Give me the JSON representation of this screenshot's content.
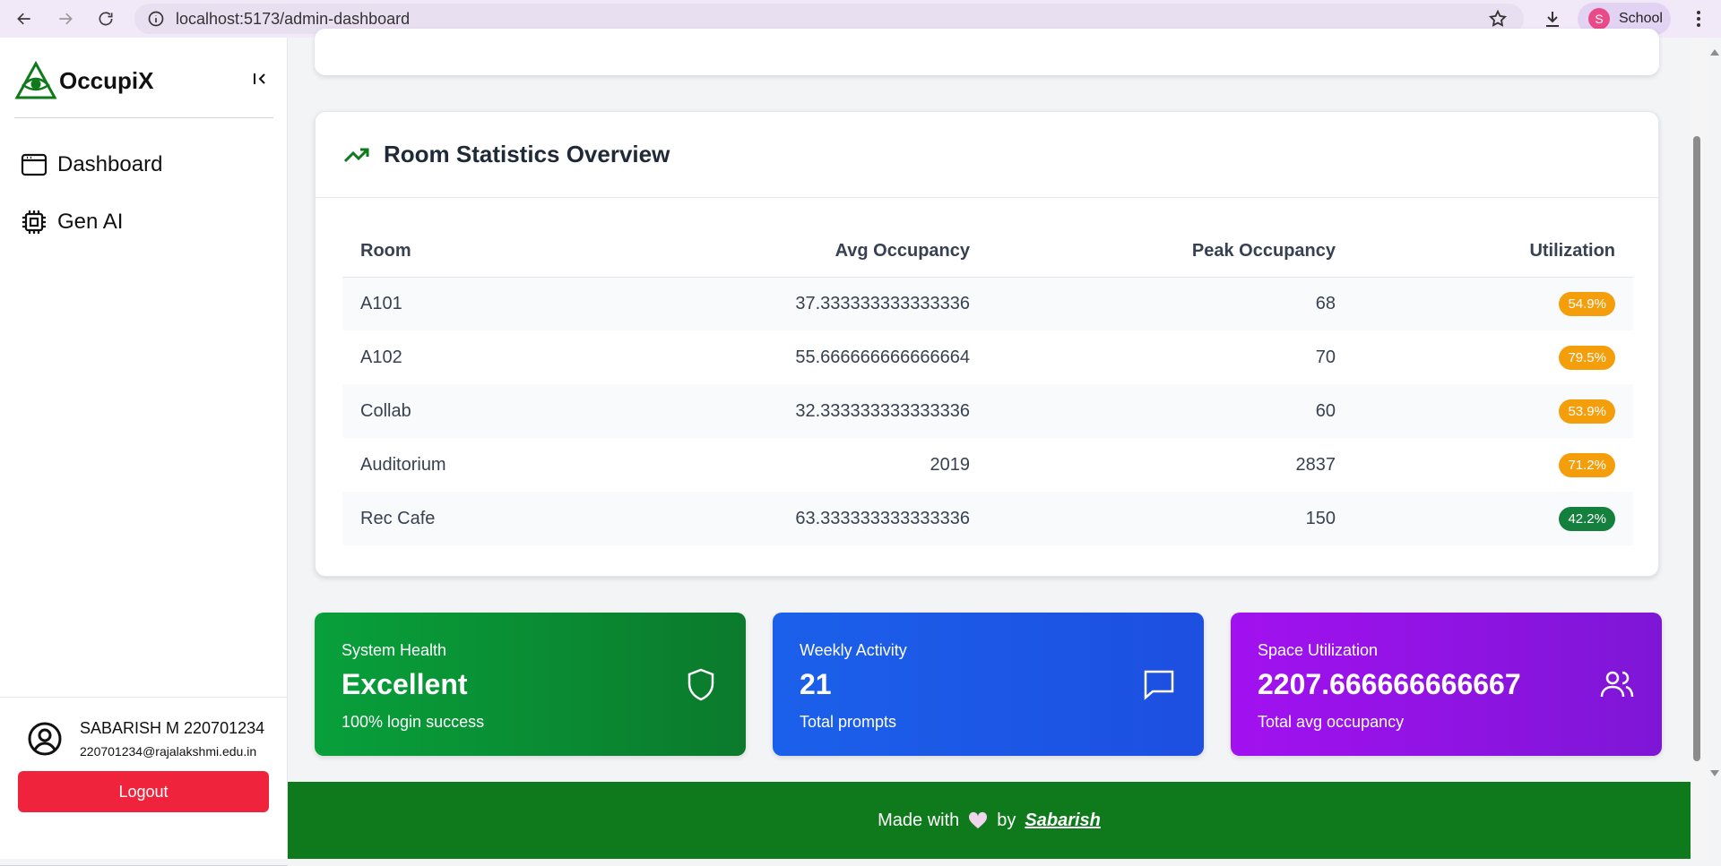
{
  "browser": {
    "url": "localhost:5173/admin-dashboard",
    "profile_initial": "S",
    "profile_label": "School"
  },
  "sidebar": {
    "app_name": "OccupiX",
    "items": [
      {
        "label": "Dashboard",
        "icon": "browser-window-icon"
      },
      {
        "label": "Gen AI",
        "icon": "cpu-chip-icon"
      }
    ],
    "user": {
      "name": "SABARISH M 220701234",
      "email": "220701234@rajalakshmi.edu.in"
    },
    "logout_label": "Logout"
  },
  "room_stats": {
    "title": "Room Statistics Overview",
    "columns": [
      "Room",
      "Avg Occupancy",
      "Peak Occupancy",
      "Utilization"
    ],
    "rows": [
      {
        "room": "A101",
        "avg": "37.333333333333336",
        "peak": "68",
        "util": "54.9%",
        "util_color": "#f59e0b"
      },
      {
        "room": "A102",
        "avg": "55.666666666666664",
        "peak": "70",
        "util": "79.5%",
        "util_color": "#f59e0b"
      },
      {
        "room": "Collab",
        "avg": "32.333333333333336",
        "peak": "60",
        "util": "53.9%",
        "util_color": "#f59e0b"
      },
      {
        "room": "Auditorium",
        "avg": "2019",
        "peak": "2837",
        "util": "71.2%",
        "util_color": "#f59e0b"
      },
      {
        "room": "Rec Cafe",
        "avg": "63.333333333333336",
        "peak": "150",
        "util": "42.2%",
        "util_color": "#15803d"
      }
    ]
  },
  "metrics": [
    {
      "label": "System Health",
      "value": "Excellent",
      "sub": "100% login success",
      "icon": "shield-icon",
      "gradient": [
        "#08a03b",
        "#0b7a2c"
      ]
    },
    {
      "label": "Weekly Activity",
      "value": "21",
      "sub": "Total prompts",
      "icon": "chat-bubble-icon",
      "gradient": [
        "#1b60ea",
        "#1d4fe0"
      ]
    },
    {
      "label": "Space Utilization",
      "value": "2207.666666666667",
      "sub": "Total avg occupancy",
      "icon": "users-icon",
      "gradient": [
        "#a211f0",
        "#7e16d6"
      ]
    }
  ],
  "footer": {
    "made_with": "Made with",
    "by": "by",
    "author": "Sabarish"
  },
  "colors": {
    "brand_green": "#0f7a1b",
    "logout_red": "#ef233c"
  }
}
